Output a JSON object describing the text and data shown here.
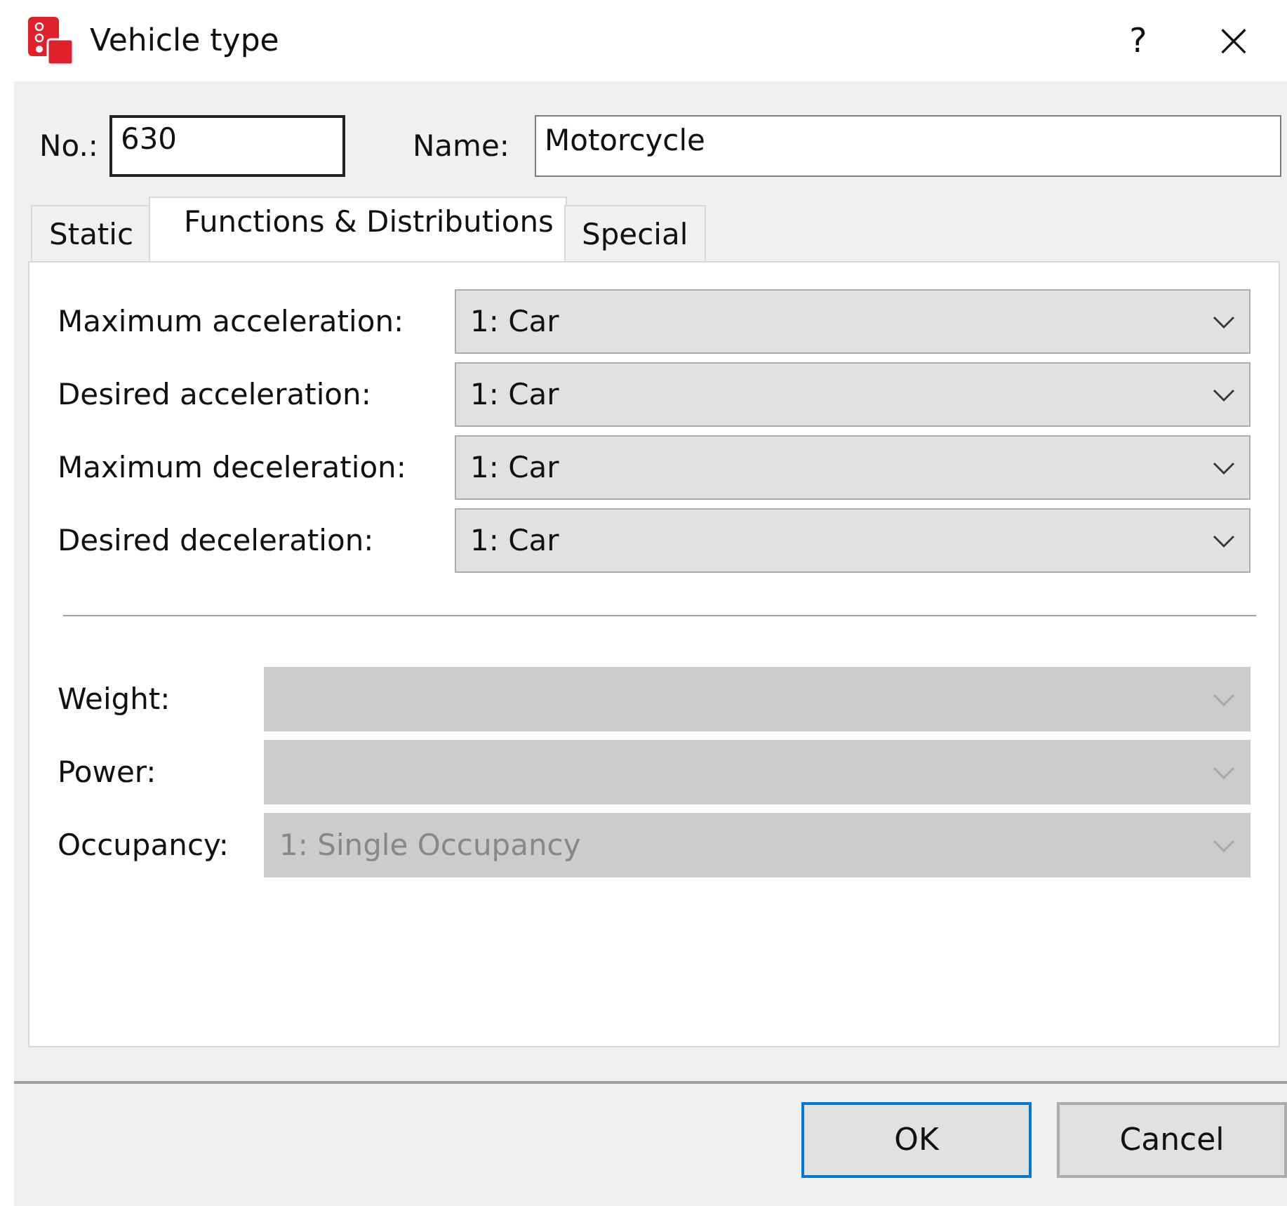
{
  "window": {
    "title": "Vehicle type",
    "help": "?",
    "close": "×"
  },
  "number": {
    "label": "No.:",
    "value": "630"
  },
  "name": {
    "label": "Name:",
    "value": "Motorcycle"
  },
  "tabs": [
    {
      "label": "Static",
      "selected": false
    },
    {
      "label": "Functions & Distributions",
      "selected": true
    },
    {
      "label": "Special",
      "selected": false
    }
  ],
  "functions": [
    {
      "label": "Maximum acceleration:",
      "value": "1: Car",
      "disabled": false
    },
    {
      "label": "Desired acceleration:",
      "value": "1: Car",
      "disabled": false
    },
    {
      "label": "Maximum deceleration:",
      "value": "1: Car",
      "disabled": false
    },
    {
      "label": "Desired deceleration:",
      "value": "1: Car",
      "disabled": false
    }
  ],
  "distributions": [
    {
      "label": "Weight:",
      "disabled": true
    },
    {
      "label": "Power:",
      "disabled": true
    },
    {
      "label": "Occupancy:",
      "value": "1: Single Occupancy",
      "disabled": true
    }
  ],
  "buttons": [
    {
      "label": "OK",
      "default": true
    },
    {
      "label": "Cancel",
      "default": false
    }
  ]
}
